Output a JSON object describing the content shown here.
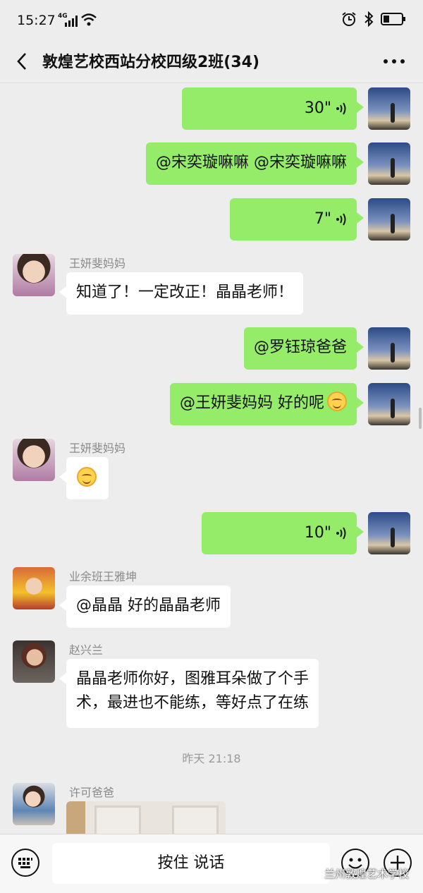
{
  "status_bar": {
    "time": "15:27",
    "network": "4G"
  },
  "header": {
    "title": "敦煌艺校西站分校四级2班(34)"
  },
  "messages": [
    {
      "from": "me",
      "type": "voice",
      "duration": "30\""
    },
    {
      "from": "me",
      "type": "text",
      "text": "@宋奕璇嘛嘛  @宋奕璇嘛嘛"
    },
    {
      "from": "me",
      "type": "voice",
      "duration": "7\""
    },
    {
      "from": "other",
      "sender": "王妍斐妈妈",
      "type": "text",
      "text": "知道了！一定改正！晶晶老师！"
    },
    {
      "from": "me",
      "type": "text",
      "text": "@罗钰琼爸爸"
    },
    {
      "from": "me",
      "type": "text",
      "text": "@王妍斐妈妈  好的呢"
    },
    {
      "from": "other",
      "sender": "王妍斐妈妈",
      "type": "emoji"
    },
    {
      "from": "me",
      "type": "voice",
      "duration": "10\""
    },
    {
      "from": "other",
      "sender": "业余班王雅坤",
      "type": "text",
      "text": "@晶晶  好的晶晶老师"
    },
    {
      "from": "other",
      "sender": "赵兴兰",
      "type": "text",
      "lines": [
        "晶晶老师你好，图雅耳朵做了个手",
        "术，最进也不能练，等好点了在练"
      ]
    },
    {
      "type": "timestamp",
      "text": "昨天 21:18"
    },
    {
      "from": "other",
      "sender": "许可爸爸",
      "type": "image"
    }
  ],
  "input_bar": {
    "hold_to_talk": "按住 说话"
  },
  "watermark": "兰州敦煌艺术学校"
}
